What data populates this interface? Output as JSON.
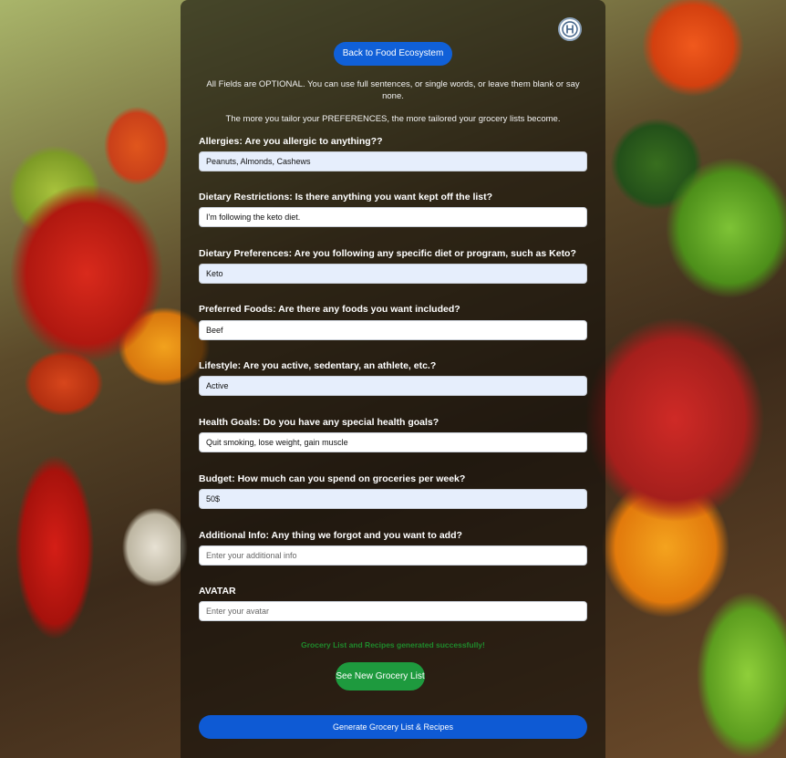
{
  "header": {
    "back_label": "Back to Food Ecosystem",
    "logo_icon": "hygieia-logo-icon"
  },
  "intro": {
    "line1": "All Fields are OPTIONAL. You can use full sentences, or single words, or leave them blank or say none.",
    "line2": "The more you tailor your PREFERENCES, the more tailored your grocery lists become."
  },
  "fields": [
    {
      "label": "Allergies: Are you allergic to anything??",
      "value": "Peanuts, Almonds, Cashews",
      "placeholder": ""
    },
    {
      "label": "Dietary Restrictions: Is there anything you want kept off the list?",
      "value": "I'm following the keto diet.",
      "placeholder": ""
    },
    {
      "label": "Dietary Preferences: Are you following any specific diet or program, such as Keto?",
      "value": "Keto",
      "placeholder": ""
    },
    {
      "label": "Preferred Foods: Are there any foods you want included?",
      "value": "Beef",
      "placeholder": ""
    },
    {
      "label": "Lifestyle: Are you active, sedentary, an athlete, etc.?",
      "value": "Active",
      "placeholder": ""
    },
    {
      "label": "Health Goals: Do you have any special health goals?",
      "value": "Quit smoking, lose weight, gain muscle",
      "placeholder": ""
    },
    {
      "label": "Budget: How much can you spend on groceries per week?",
      "value": "50$",
      "placeholder": ""
    },
    {
      "label": "Additional Info: Any thing we forgot and you want to add?",
      "value": "",
      "placeholder": "Enter your additional info"
    },
    {
      "label": "AVATAR",
      "value": "",
      "placeholder": "Enter your avatar"
    }
  ],
  "status": {
    "success_message": "Grocery List and Recipes generated successfully!"
  },
  "actions": {
    "see_grocery_label": "See New Grocery List",
    "generate_label": "Generate Grocery List & Recipes"
  },
  "colors": {
    "primary_blue": "#1060d8",
    "success_green": "#1e9a3e",
    "filled_input_bg": "#e6eefc"
  }
}
